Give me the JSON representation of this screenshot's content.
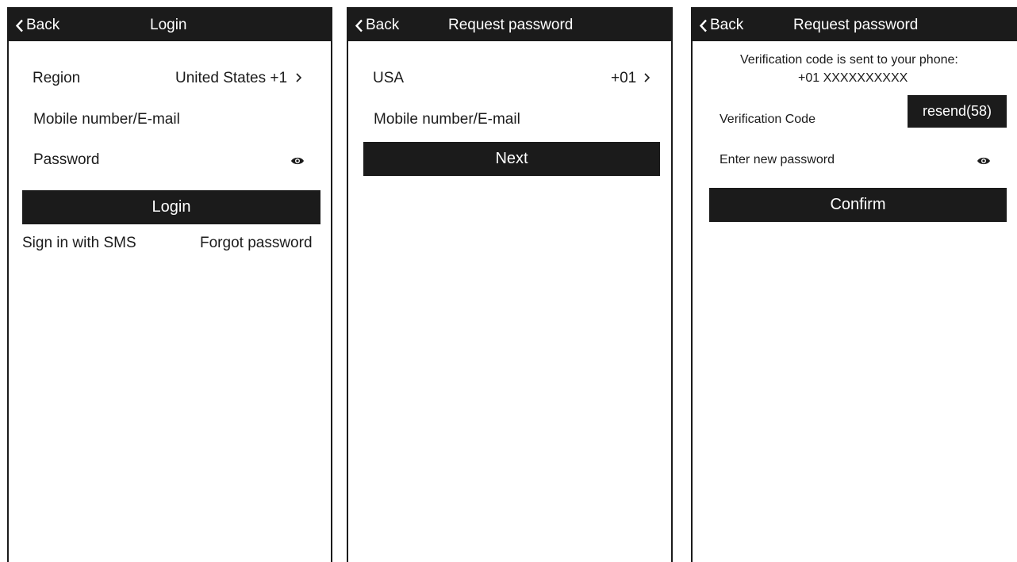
{
  "screens": [
    {
      "back_label": "Back",
      "title": "Login",
      "region_label": "Region",
      "region_value": "United States +1",
      "mobile_label": "Mobile number/E-mail",
      "password_label": "Password",
      "login_button": "Login",
      "sms_link": "Sign in with SMS",
      "forgot_link": "Forgot password"
    },
    {
      "back_label": "Back",
      "title": "Request password",
      "country": "USA",
      "country_code": "+01",
      "mobile_label": "Mobile number/E-mail",
      "next_button": "Next"
    },
    {
      "back_label": "Back",
      "title": "Request password",
      "sent_message": "Verification code is sent to your phone:",
      "phone_number": "+01 XXXXXXXXXX",
      "code_label": "Verification Code",
      "resend_button": "resend(58)",
      "new_password_label": "Enter new password",
      "confirm_button": "Confirm"
    }
  ],
  "icons": {
    "back": "chevron-left-icon",
    "forward": "chevron-right-icon",
    "show_password": "eye-icon"
  }
}
